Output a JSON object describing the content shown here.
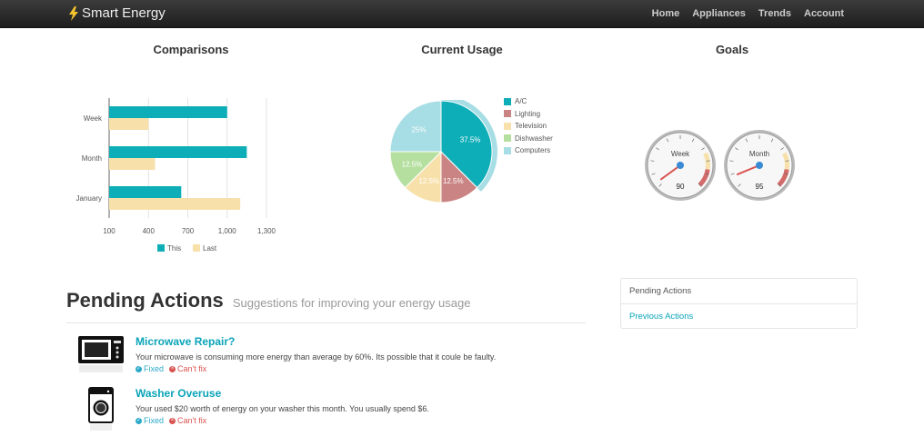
{
  "nav": {
    "brand": "Smart Energy",
    "links": [
      "Home",
      "Appliances",
      "Trends",
      "Account"
    ]
  },
  "sections": {
    "comparisons": "Comparisons",
    "current_usage": "Current Usage",
    "goals": "Goals"
  },
  "chart_data": [
    {
      "type": "bar",
      "orientation": "horizontal",
      "title": "Comparisons",
      "categories": [
        "Week",
        "Month",
        "January"
      ],
      "series": [
        {
          "name": "This",
          "values": [
            1000,
            1150,
            650
          ],
          "color": "#0eaeb8"
        },
        {
          "name": "Last",
          "values": [
            400,
            450,
            1100
          ],
          "color": "#f7e0aa"
        }
      ],
      "xlim": [
        100,
        1300
      ],
      "xticks": [
        "100",
        "400",
        "700",
        "1,000",
        "1,300"
      ],
      "grid": true,
      "legend": "bottom"
    },
    {
      "type": "pie",
      "title": "Current Usage",
      "slices": [
        {
          "name": "A/C",
          "value": 37.5,
          "label": "37.5%",
          "color": "#0eaeb8"
        },
        {
          "name": "Lighting",
          "value": 12.5,
          "label": "12.5%",
          "color": "#c98483"
        },
        {
          "name": "Television",
          "value": 12.5,
          "label": "12.5%",
          "color": "#f7e0aa"
        },
        {
          "name": "Dishwasher",
          "value": 12.5,
          "label": "12.5%",
          "color": "#b5df9f"
        },
        {
          "name": "Computers",
          "value": 25,
          "label": "25%",
          "color": "#a7dde4"
        }
      ],
      "legend": "right"
    }
  ],
  "gauges": [
    {
      "label": "Week",
      "value": "90",
      "level": 0.9
    },
    {
      "label": "Month",
      "value": "95",
      "level": 0.95
    }
  ],
  "pending": {
    "title": "Pending Actions",
    "subtitle": "Suggestions for improving your energy usage",
    "items": [
      {
        "icon": "microwave-icon",
        "title": "Microwave Repair?",
        "desc": "Your microwave is consuming more energy than average by 60%. Its possible that it coule be faulty.",
        "fixed": "Fixed",
        "cant": "Can't fix"
      },
      {
        "icon": "washer-icon",
        "title": "Washer Overuse",
        "desc": "Your used $20 worth of energy on your washer this month. You usually spend $6.",
        "fixed": "Fixed",
        "cant": "Can't fix"
      }
    ]
  },
  "side": {
    "items": [
      "Pending Actions",
      "Previous Actions"
    ]
  },
  "colors": {
    "accent": "#0aa4b8",
    "danger": "#d9534f",
    "navbar": "#2a2a2a"
  }
}
